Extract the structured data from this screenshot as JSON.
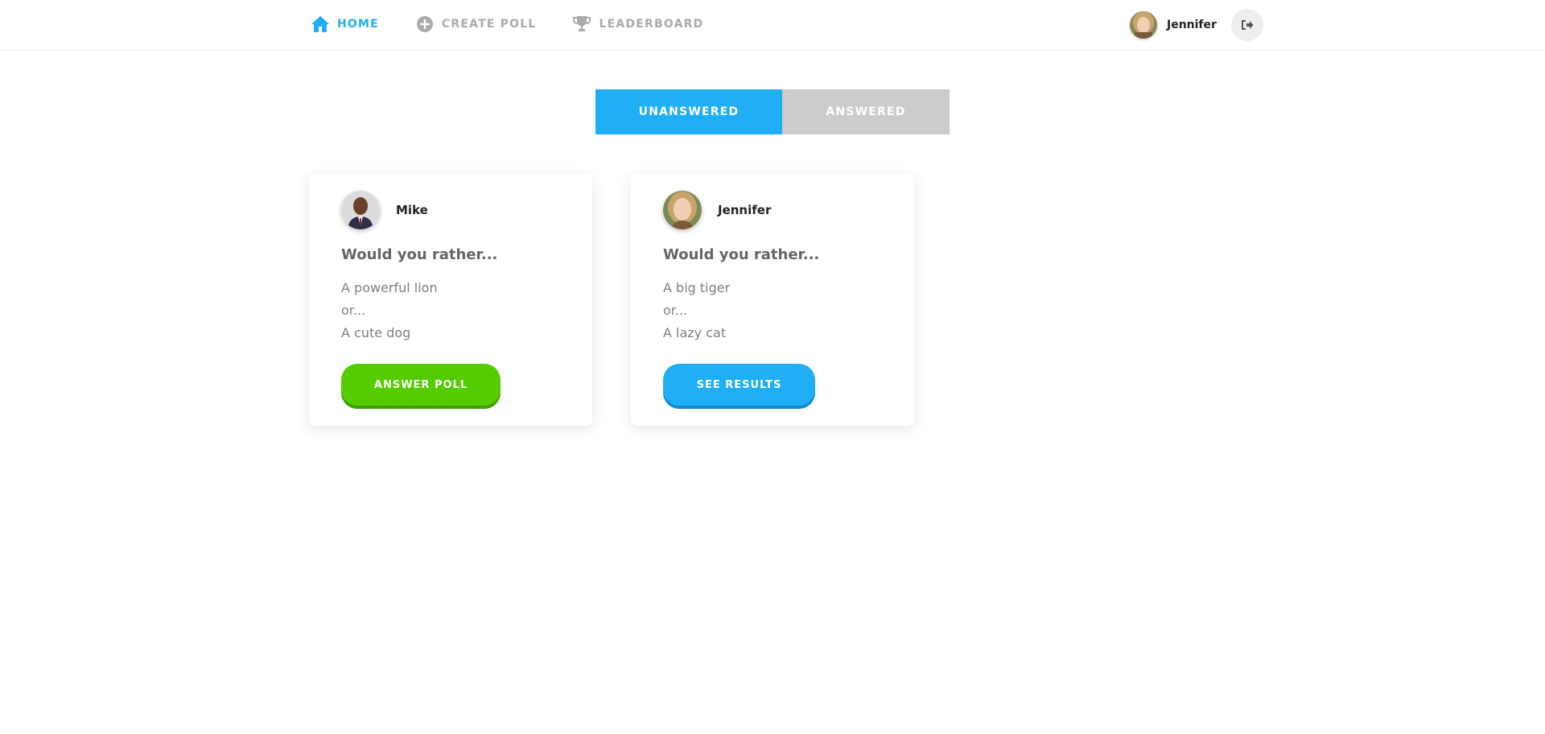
{
  "nav": {
    "items": [
      {
        "label": "HOME",
        "icon": "home-icon",
        "active": true
      },
      {
        "label": "CREATE POLL",
        "icon": "plus-circle-icon",
        "active": false
      },
      {
        "label": "LEADERBOARD",
        "icon": "trophy-icon",
        "active": false
      }
    ],
    "user": {
      "name": "Jennifer"
    },
    "logout_icon": "logout-icon"
  },
  "tabs": [
    {
      "label": "UNANSWERED",
      "active": true
    },
    {
      "label": "ANSWERED",
      "active": false
    }
  ],
  "polls": [
    {
      "author": "Mike",
      "question": "Would you rather...",
      "option_one": "A powerful lion",
      "separator": "or...",
      "option_two": "A cute dog",
      "button_label": "ANSWER POLL"
    },
    {
      "author": "Jennifer",
      "question": "Would you rather...",
      "option_one": "A big tiger",
      "separator": "or...",
      "option_two": "A lazy cat",
      "button_label": "SEE RESULTS"
    }
  ],
  "colors": {
    "accent": "#20aef5",
    "nav_inactive": "#aaaaaa",
    "tab_inactive": "#cccccc",
    "answer_button": "#55cc00"
  }
}
